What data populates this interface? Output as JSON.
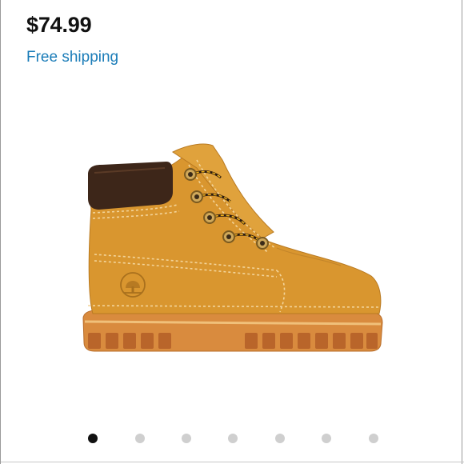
{
  "product": {
    "price": "$74.99",
    "shipping": "Free shipping",
    "image_name": "boot-image"
  },
  "pager": {
    "count": 7,
    "active_index": 0
  },
  "colors": {
    "price": "#111111",
    "shipping_link": "#1a7cb8",
    "dot_active": "#111111",
    "dot_inactive": "#cfcfcf",
    "boot_wheat": "#d9962f",
    "collar_brown": "#3d2619"
  }
}
